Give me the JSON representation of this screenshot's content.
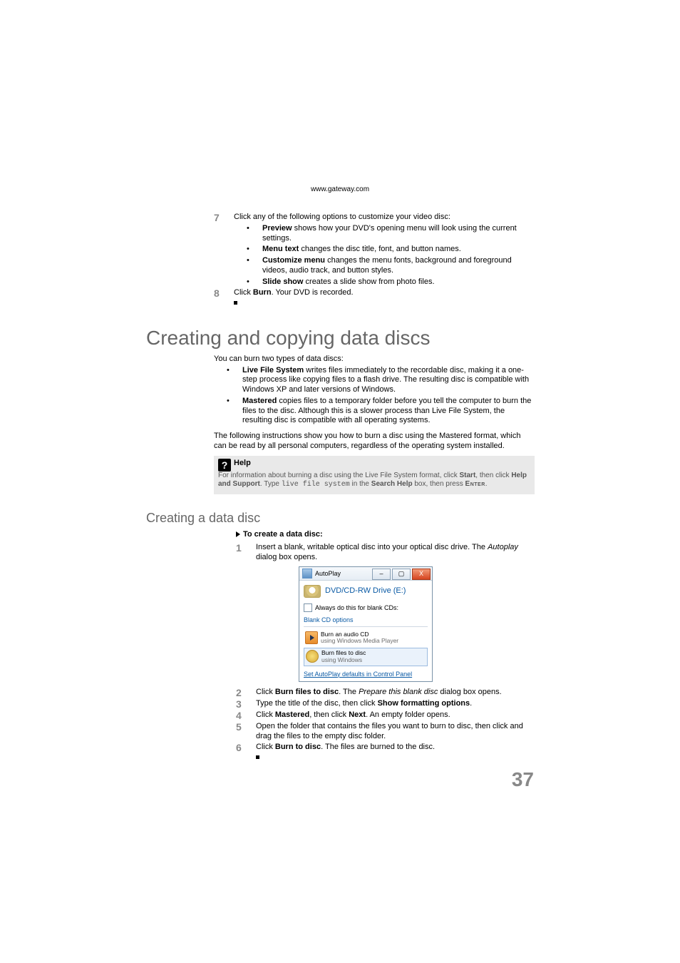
{
  "header_url": "www.gateway.com",
  "page_number": "37",
  "step7": {
    "num": "7",
    "text": "Click any of the following options to customize your video disc:",
    "bullets": [
      {
        "bold": "Preview",
        "rest": " shows how your DVD's opening menu will look using the current settings."
      },
      {
        "bold": "Menu text",
        "rest": " changes the disc title, font, and button names."
      },
      {
        "bold": "Customize menu",
        "rest": " changes the menu fonts, background and foreground videos, audio track, and button styles."
      },
      {
        "bold": "Slide show",
        "rest": " creates a slide show from photo files."
      }
    ]
  },
  "step8": {
    "num": "8",
    "pre": "Click ",
    "bold": "Burn",
    "post": ". Your DVD is recorded."
  },
  "section_title": "Creating and copying data discs",
  "intro": "You can burn two types of data discs:",
  "intro_bullets": [
    {
      "bold": "Live File System",
      "rest": " writes files immediately to the recordable disc, making it a one-step process like copying files to a flash drive. The resulting disc is compatible with Windows XP and later versions of Windows."
    },
    {
      "bold": "Mastered",
      "rest": " copies files to a temporary folder before you tell the computer to burn the files to the disc. Although this is a slower process than Live File System, the resulting disc is compatible with all operating systems."
    }
  ],
  "intro_after": "The following instructions show you how to burn a disc using the Mastered format, which can be read by all personal computers, regardless of the operating system installed.",
  "help": {
    "title": "Help",
    "l1a": "For information about burning a disc using the Live File System format, click ",
    "l1b": "Start",
    "l2a": ", then click ",
    "l2b": "Help and Support",
    "l2c": ". Type ",
    "l2d": "live file system",
    "l2e": " in the ",
    "l2f": "Search Help",
    "l2g": " box, then press ",
    "l2h": "Enter",
    "l2i": "."
  },
  "subsection_title": "Creating a data disc",
  "procedure_heading": "To create a data disc:",
  "p1": {
    "num": "1",
    "a": "Insert a blank, writable optical disc into your optical disc drive. The ",
    "i": "Autoplay",
    "b": " dialog box opens."
  },
  "autoplay": {
    "title": "AutoPlay",
    "drive": "DVD/CD-RW Drive (E:)",
    "always": "Always do this for blank CDs:",
    "section": "Blank CD options",
    "opt1": "Burn an audio CD",
    "opt1sub": "using Windows Media Player",
    "opt2": "Burn files to disc",
    "opt2sub": "using Windows",
    "link": "Set AutoPlay defaults in Control Panel"
  },
  "p2": {
    "num": "2",
    "a": "Click ",
    "b1": "Burn files to disc",
    "c": ". The ",
    "i": "Prepare this blank disc",
    "d": " dialog box opens."
  },
  "p3": {
    "num": "3",
    "a": "Type the title of the disc, then click ",
    "b1": "Show formatting options",
    "c": "."
  },
  "p4": {
    "num": "4",
    "a": "Click ",
    "b1": "Mastered",
    "c": ", then click ",
    "b2": "Next",
    "d": ". An empty folder opens."
  },
  "p5": {
    "num": "5",
    "a": "Open the folder that contains the files you want to burn to disc, then click and drag the files to the empty disc folder."
  },
  "p6": {
    "num": "6",
    "a": "Click ",
    "b1": "Burn to disc",
    "c": ". The files are burned to the disc."
  }
}
